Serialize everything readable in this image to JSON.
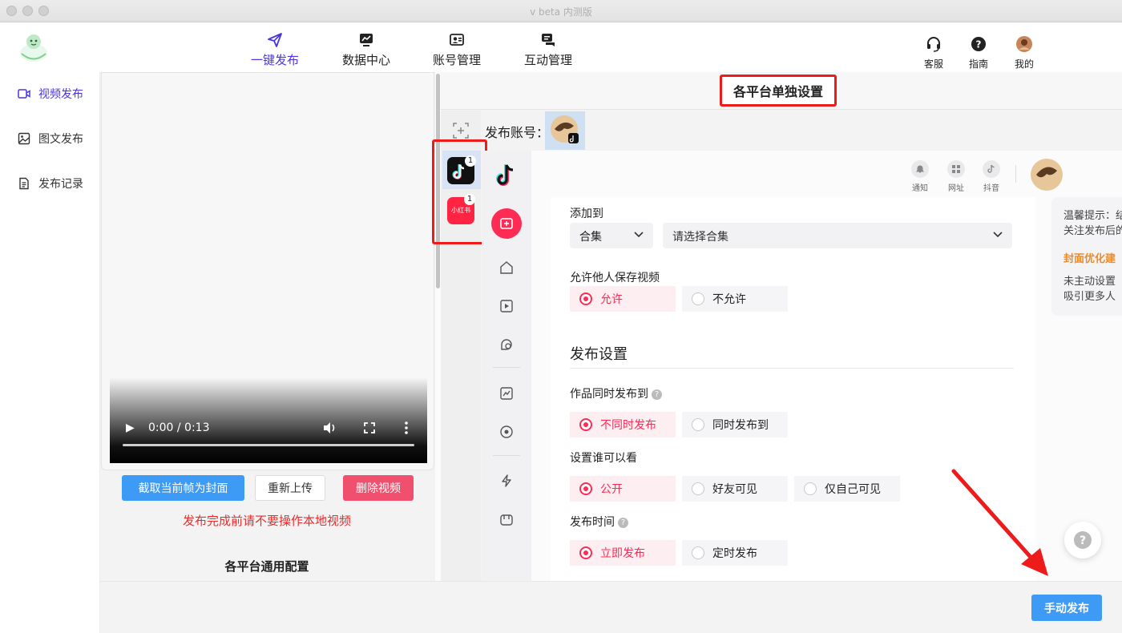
{
  "window": {
    "title": "v beta 内测版"
  },
  "nav": [
    {
      "label": "一键发布",
      "icon": "send-icon",
      "active": true
    },
    {
      "label": "数据中心",
      "icon": "chart-monitor-icon",
      "active": false
    },
    {
      "label": "账号管理",
      "icon": "account-card-icon",
      "active": false
    },
    {
      "label": "互动管理",
      "icon": "chat-icon",
      "active": false
    }
  ],
  "header_right": [
    {
      "label": "客服",
      "icon": "headset-icon"
    },
    {
      "label": "指南",
      "icon": "help-icon"
    },
    {
      "label": "我的",
      "icon": "avatar"
    }
  ],
  "sidebar": [
    {
      "label": "视频发布",
      "icon": "video-icon",
      "active": true
    },
    {
      "label": "图文发布",
      "icon": "image-icon",
      "active": false
    },
    {
      "label": "发布记录",
      "icon": "document-icon",
      "active": false
    }
  ],
  "video": {
    "time": "0:00 / 0:13",
    "capture_cover_label": "截取当前帧为封面",
    "reupload_label": "重新上传",
    "delete_label": "删除视频",
    "warning": "发布完成前请不要操作本地视频",
    "common_config_title": "各平台通用配置"
  },
  "platform_settings": {
    "title": "各平台单独设置",
    "account_label": "发布账号：",
    "platforms": [
      {
        "name": "抖音",
        "badge": "1"
      },
      {
        "name": "小红书",
        "badge": "1"
      }
    ]
  },
  "douyin": {
    "top_icons": [
      {
        "label": "通知",
        "icon": "bell-icon"
      },
      {
        "label": "网址",
        "icon": "grid-icon"
      },
      {
        "label": "抖音",
        "icon": "douyin-icon"
      }
    ],
    "add_to": {
      "label": "添加到",
      "type_value": "合集",
      "select_placeholder": "请选择合集"
    },
    "allow_save": {
      "label": "允许他人保存视频",
      "options": [
        "允许",
        "不允许"
      ]
    },
    "section_title": "发布设置",
    "sync_publish": {
      "label": "作品同时发布到",
      "options": [
        "不同时发布",
        "同时发布到"
      ]
    },
    "visibility": {
      "label": "设置谁可以看",
      "options": [
        "公开",
        "好友可见",
        "仅自己可见"
      ]
    },
    "publish_time": {
      "label": "发布时间",
      "options": [
        "立即发布",
        "定时发布"
      ]
    },
    "tips": {
      "line1": "温馨提示：结",
      "line2": "关注发布后的",
      "cover_title": "封面优化建",
      "line3": "未主动设置",
      "line4": "吸引更多人"
    }
  },
  "manual_publish_label": "手动发布",
  "colors": {
    "accent": "#4b35e0",
    "douyin_red": "#fe2c55",
    "primary_blue": "#3d9bf5",
    "danger": "#f0506e",
    "annotation_red": "#ee1b1b"
  }
}
